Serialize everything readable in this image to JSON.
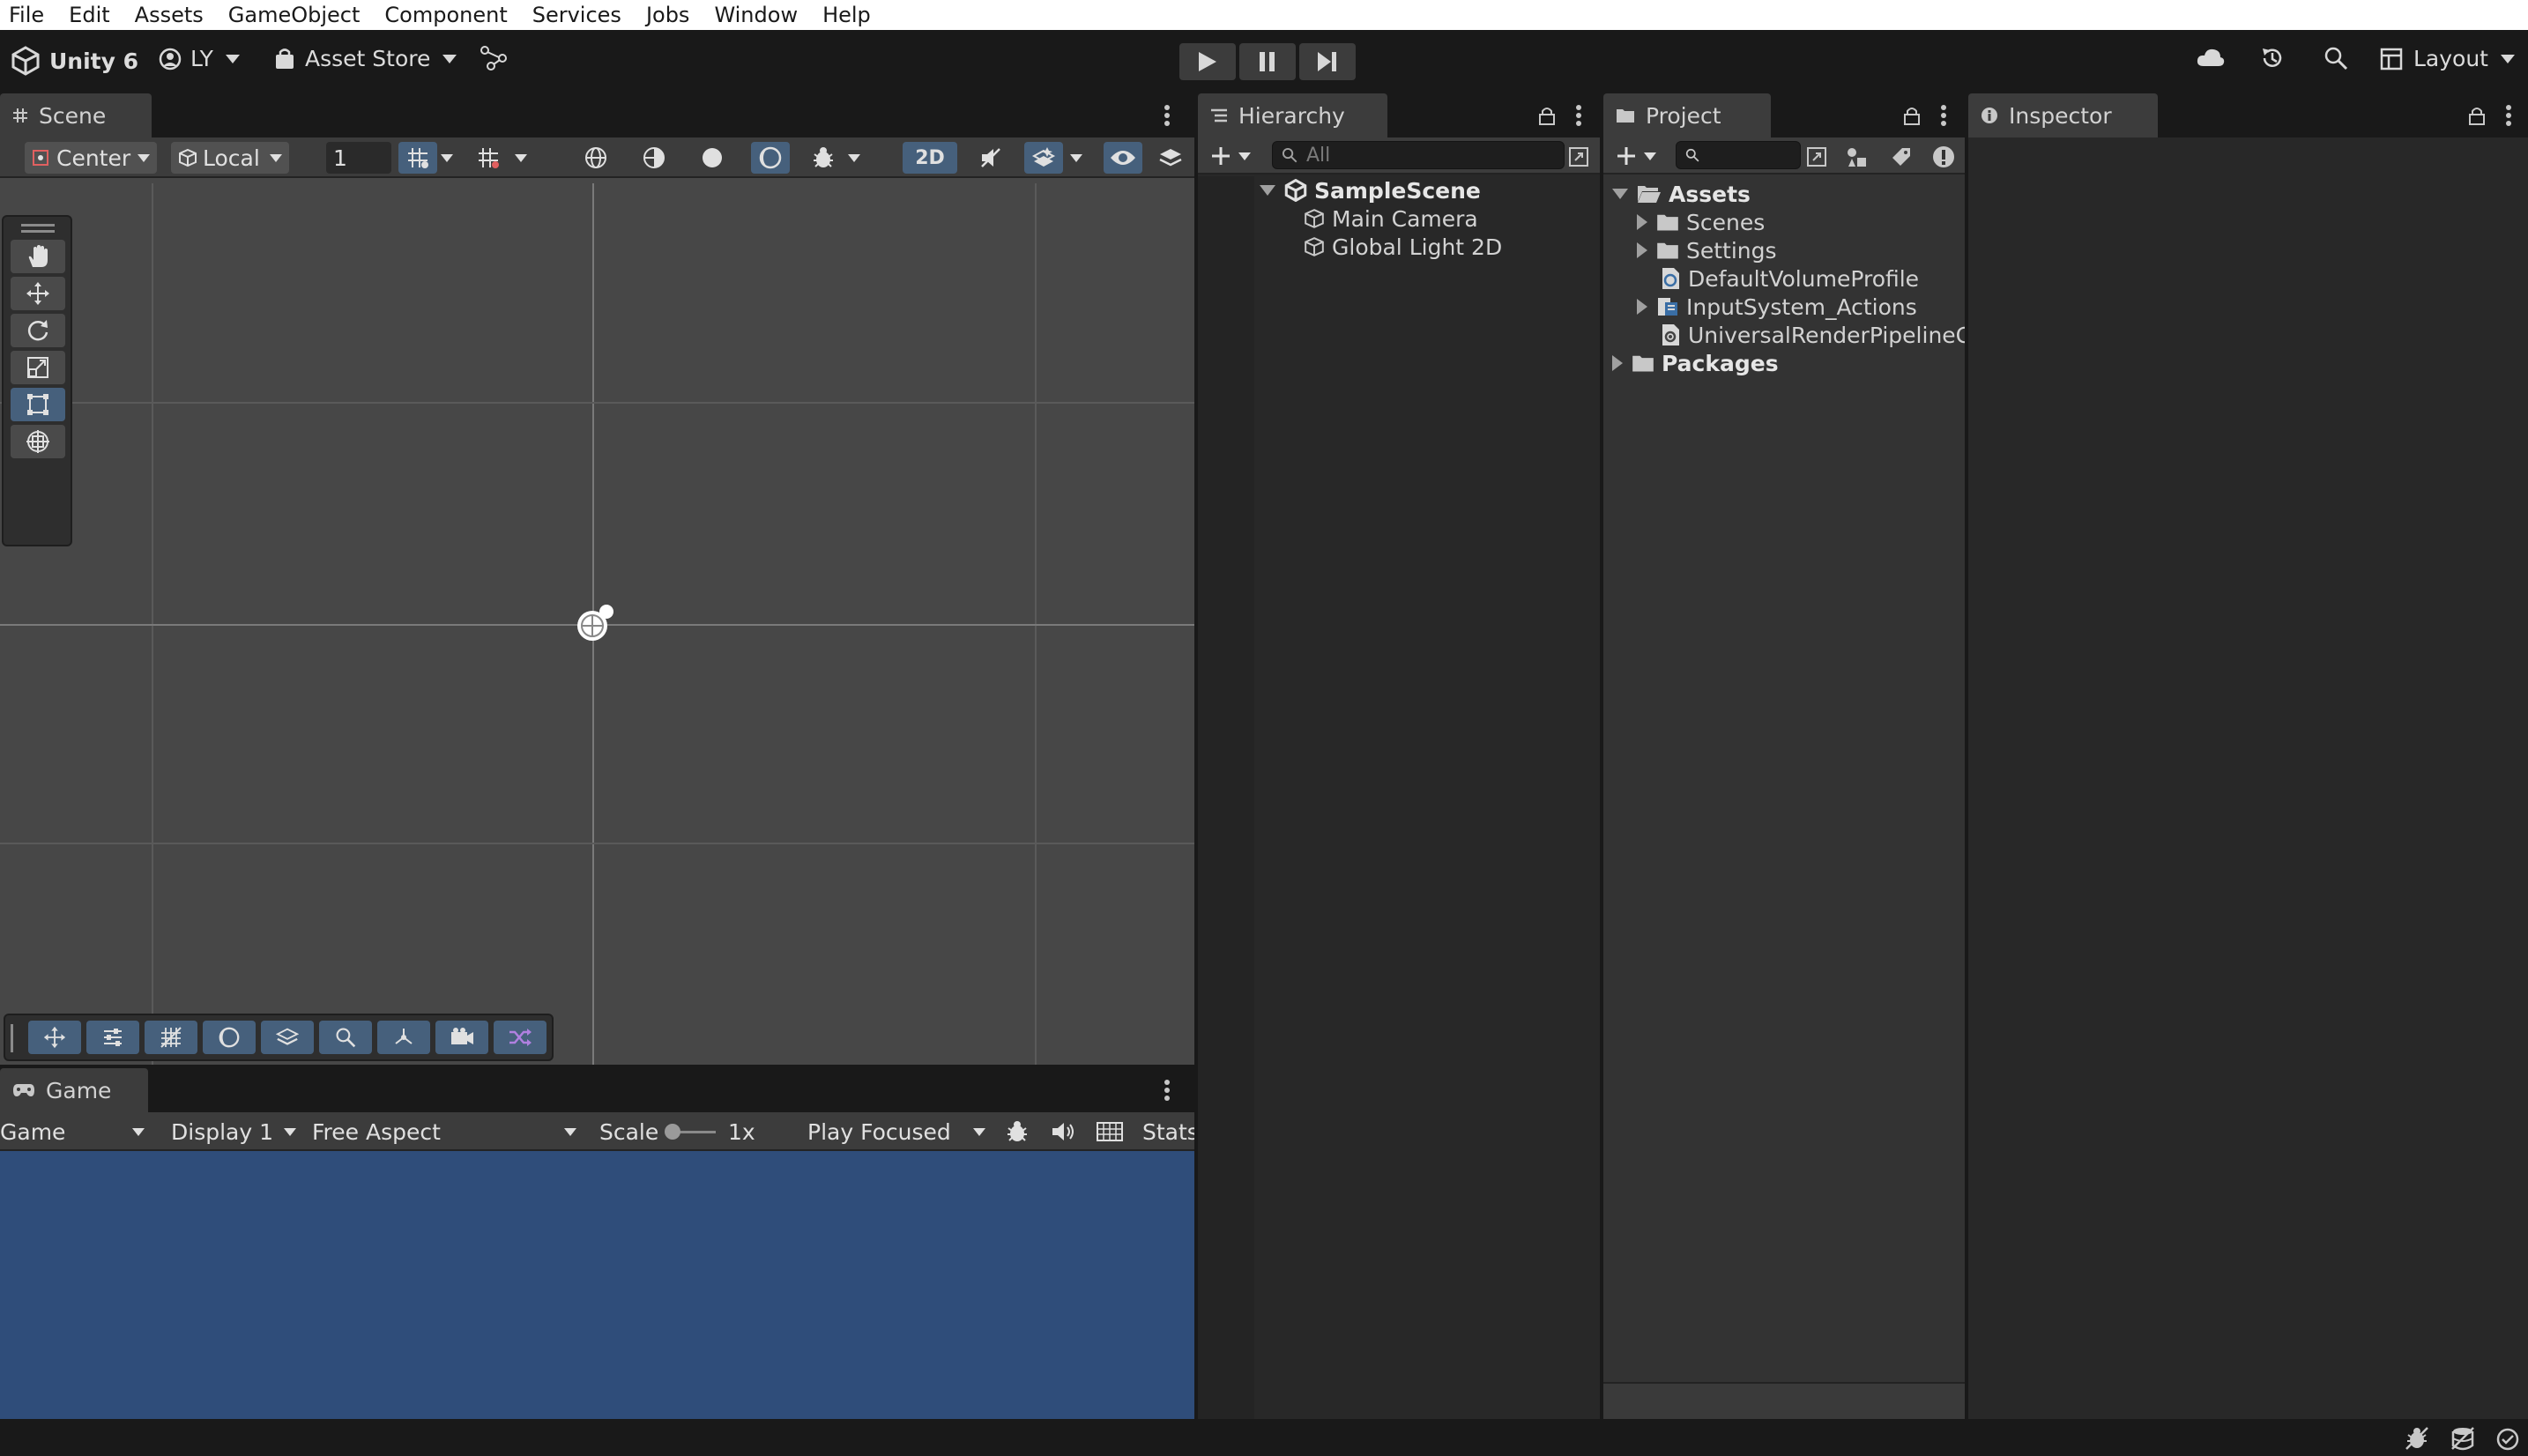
{
  "menu": [
    "File",
    "Edit",
    "Assets",
    "GameObject",
    "Component",
    "Services",
    "Jobs",
    "Window",
    "Help"
  ],
  "toolbar": {
    "product": "Unity 6",
    "account": "LY",
    "asset_store": "Asset Store",
    "layout": "Layout"
  },
  "scene": {
    "tab": "Scene",
    "pivot": "Center",
    "space": "Local",
    "grid_size": "1",
    "mode_2d": "2D"
  },
  "game": {
    "tab": "Game",
    "view_select": "Game",
    "display": "Display 1",
    "aspect": "Free Aspect",
    "scale_label": "Scale",
    "scale_value": "1x",
    "play_mode": "Play Focused",
    "stats": "Stats"
  },
  "hierarchy": {
    "tab": "Hierarchy",
    "search_placeholder": "All",
    "scene_name": "SampleScene",
    "items": [
      "Main Camera",
      "Global Light 2D"
    ]
  },
  "project": {
    "tab": "Project",
    "root": "Assets",
    "asset_items": [
      "Scenes",
      "Settings",
      "DefaultVolumeProfile",
      "InputSystem_Actions",
      "UniversalRenderPipelineGlo"
    ],
    "packages": "Packages"
  },
  "inspector": {
    "tab": "Inspector"
  },
  "colors": {
    "accent": "#46607c",
    "game_bg": "#2f4d7a",
    "panel_bg": "#282828",
    "scene_bg": "#474747"
  }
}
